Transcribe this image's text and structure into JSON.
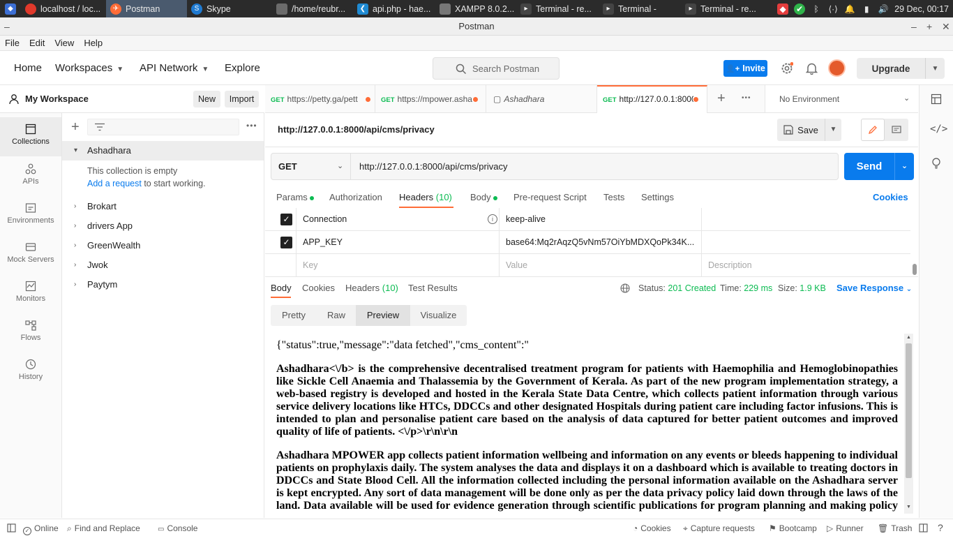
{
  "taskbar": {
    "tasks": [
      {
        "label": "localhost / loc...",
        "icon": "chrome-icon",
        "color": "#e0392b"
      },
      {
        "label": "Postman",
        "icon": "postman-icon",
        "color": "#ff6c37"
      },
      {
        "label": "Skype",
        "icon": "skype-icon",
        "color": "#1f7ad1"
      },
      {
        "label": "/home/reubr...",
        "icon": "folder-icon",
        "color": "#6b6b6b"
      },
      {
        "label": "api.php - hae...",
        "icon": "vscode-icon",
        "color": "#1f8ad2"
      },
      {
        "label": "XAMPP 8.0.2...",
        "icon": "xampp-icon",
        "color": "#777"
      },
      {
        "label": "Terminal - re...",
        "icon": "terminal-icon",
        "color": "#444"
      },
      {
        "label": "Terminal -",
        "icon": "terminal-icon",
        "color": "#444"
      },
      {
        "label": "Terminal - re...",
        "icon": "terminal-icon",
        "color": "#444"
      }
    ],
    "clock": "29 Dec, 00:17"
  },
  "window": {
    "title": "Postman"
  },
  "menu": [
    "File",
    "Edit",
    "View",
    "Help"
  ],
  "header": {
    "home": "Home",
    "workspaces": "Workspaces",
    "api_network": "API Network",
    "explore": "Explore",
    "search_placeholder": "Search Postman",
    "invite": "Invite",
    "upgrade": "Upgrade"
  },
  "rail": [
    {
      "label": "Collections",
      "icon": "collections-icon"
    },
    {
      "label": "APIs",
      "icon": "apis-icon"
    },
    {
      "label": "Environments",
      "icon": "environments-icon"
    },
    {
      "label": "Mock Servers",
      "icon": "mock-servers-icon"
    },
    {
      "label": "Monitors",
      "icon": "monitors-icon"
    },
    {
      "label": "Flows",
      "icon": "flows-icon"
    },
    {
      "label": "History",
      "icon": "history-icon"
    }
  ],
  "sidebar": {
    "workspace": "My Workspace",
    "new": "New",
    "import": "Import",
    "expanded": "Ashadhara",
    "empty_text": "This collection is empty",
    "add_request_link": "Add a request",
    "add_request_rest": " to start working.",
    "collections": [
      "Brokart",
      "drivers App",
      "GreenWealth",
      "Jwok",
      "Paytym"
    ]
  },
  "tabs": [
    {
      "method": "GET",
      "label": "https://petty.ga/pett"
    },
    {
      "method": "GET",
      "label": "https://mpower.asha"
    },
    {
      "method": "",
      "label": "Ashadhara"
    },
    {
      "method": "GET",
      "label": "http://127.0.0.1:8000"
    }
  ],
  "environment": "No Environment",
  "request": {
    "title": "http://127.0.0.1:8000/api/cms/privacy",
    "save": "Save",
    "method": "GET",
    "url": "http://127.0.0.1:8000/api/cms/privacy",
    "send": "Send",
    "subtabs": {
      "params": "Params",
      "authorization": "Authorization",
      "headers": "Headers",
      "headers_count": "(10)",
      "body": "Body",
      "pre_request": "Pre-request Script",
      "tests": "Tests",
      "settings": "Settings",
      "cookies": "Cookies"
    },
    "headers": [
      {
        "key": "Connection",
        "value": "keep-alive"
      },
      {
        "key": "APP_KEY",
        "value": "base64:Mq2rAqzQ5vNm57OiYbMDXQoPk34K..."
      }
    ],
    "placeholders": {
      "key": "Key",
      "value": "Value",
      "description": "Description"
    }
  },
  "response": {
    "tabs": {
      "body": "Body",
      "cookies": "Cookies",
      "headers": "Headers",
      "headers_count": "(10)",
      "test_results": "Test Results"
    },
    "status_label": "Status:",
    "status": "201 Created",
    "time_label": "Time:",
    "time": "229 ms",
    "size_label": "Size:",
    "size": "1.9 KB",
    "save_response": "Save Response",
    "view_tabs": [
      "Pretty",
      "Raw",
      "Preview",
      "Visualize"
    ],
    "preview": {
      "line1": "{\"status\":true,\"message\":\"data fetched\",\"cms_content\":\"",
      "para1": "Ashadhara<\\/b> is the comprehensive decentralised treatment program for patients with Haemophilia and Hemoglobinopathies like Sickle Cell Anaemia and Thalassemia by the Government of Kerala. As part of the new program implementation strategy, a web-based registry is developed and hosted in the Kerala State Data Centre, which collects patient information through various service delivery locations like HTCs, DDCCs and other designated Hospitals during patient care including factor infusions. This is intended to plan and personalise patient care based on the analysis of data captured for better patient outcomes and improved quality of life of patients. <\\/p>\\r\\n\\r\\n",
      "para2": "Ashadhara MPOWER app collects patient information wellbeing and information on any events or bleeds happening to individual patients on prophylaxis daily. The system analyses the data and displays it on a dashboard which is available to treating doctors in DDCCs and State Blood Cell. All the information collected including the personal information available on the Ashadhara server is kept encrypted. Any sort of data management will be done only as per the data privacy policy laid down through the laws of the land. Data available will be used for evidence generation through scientific publications for program planning and making policy decisions. All the data stored in the system for processing will be anonymised to protect the privacy of individuals."
    }
  },
  "statusbar": {
    "online": "Online",
    "find_replace": "Find and Replace",
    "console": "Console",
    "cookies": "Cookies",
    "capture": "Capture requests",
    "bootcamp": "Bootcamp",
    "runner": "Runner",
    "trash": "Trash"
  },
  "colors": {
    "accent": "#ff6c37",
    "primary": "#097bed",
    "get": "#0cbb52",
    "status_ok": "#0cbb52"
  }
}
